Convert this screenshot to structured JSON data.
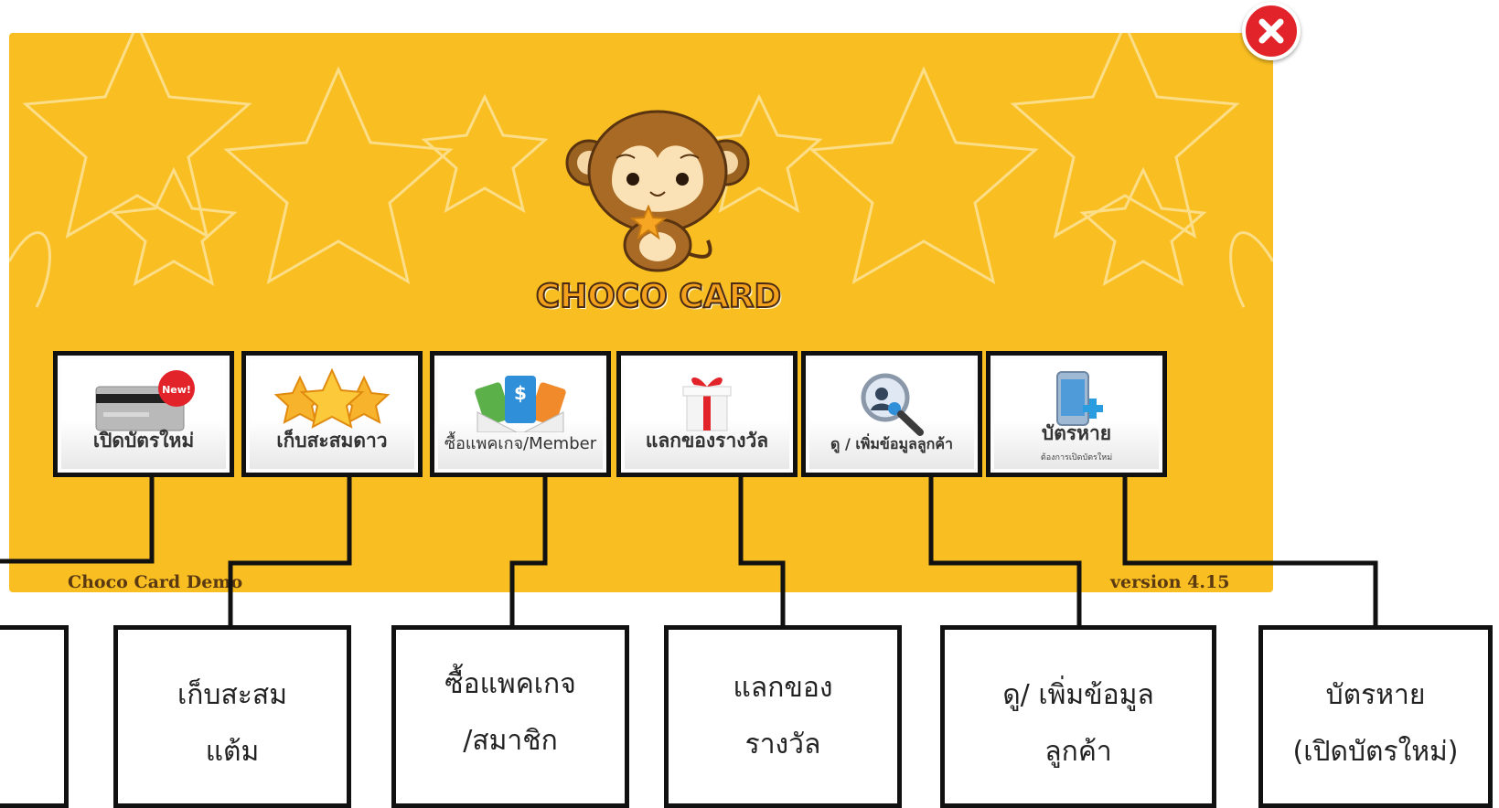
{
  "dialog": {
    "brand": "CHOCO CARD",
    "footer_left": "Choco Card Demo",
    "footer_right": "version 4.15"
  },
  "menu": [
    {
      "label": "เปิดบัตรใหม่",
      "badge": "New!"
    },
    {
      "label": "เก็บสะสมดาว"
    },
    {
      "label": "ซื้อแพคเกจ/Member"
    },
    {
      "label": "แลกของรางวัล"
    },
    {
      "label": "ดู / เพิ่มข้อมูลลูกค้า"
    },
    {
      "label": "บัตรหาย",
      "sub": "ต้องการเปิดบัตรใหม่"
    }
  ],
  "callouts": [
    {
      "line1": "",
      "line2": ""
    },
    {
      "line1": "เก็บสะสม",
      "line2": "แต้ม"
    },
    {
      "line1": "ซื้อแพคเกจ",
      "line2": "/สมาชิก"
    },
    {
      "line1": "แลกของ",
      "line2": "รางวัล"
    },
    {
      "line1": "ดู/ เพิ่มข้อมูล",
      "line2": "ลูกค้า"
    },
    {
      "line1": "บัตรหาย",
      "line2": "(เปิดบัตรใหม่)"
    }
  ],
  "icons": {
    "close": "close-icon",
    "mascot": "monkey-mascot-icon",
    "card": "credit-card-icon",
    "stars": "stars-icon",
    "package": "package-cards-icon",
    "gift": "gift-icon",
    "search_user": "search-user-icon",
    "phone_add": "phone-add-icon"
  },
  "colors": {
    "panel": "#f9bf22",
    "close": "#e2232a",
    "border": "#111111"
  }
}
